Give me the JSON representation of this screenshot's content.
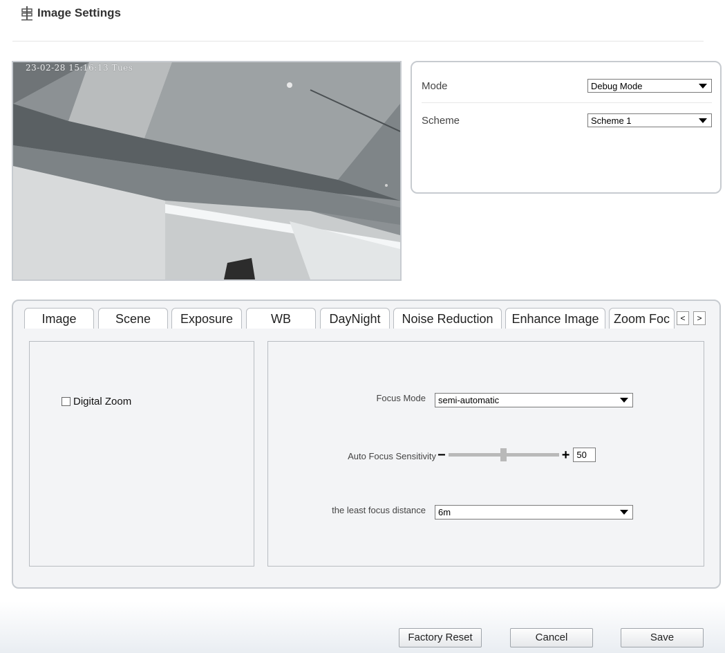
{
  "header": {
    "title": "Image Settings",
    "icon": "signpost-icon"
  },
  "preview": {
    "osd_text": "23-02-28 15:16:13 Tues"
  },
  "mode_panel": {
    "mode_label": "Mode",
    "mode_value": "Debug Mode",
    "scheme_label": "Scheme",
    "scheme_value": "Scheme 1"
  },
  "tabs": [
    {
      "label": "Image"
    },
    {
      "label": "Scene"
    },
    {
      "label": "Exposure"
    },
    {
      "label": "WB"
    },
    {
      "label": "DayNight"
    },
    {
      "label": "Noise Reduction"
    },
    {
      "label": "Enhance Image"
    },
    {
      "label": "Zoom Foc",
      "active": true
    }
  ],
  "tab_scroll": {
    "left": "<",
    "right": ">"
  },
  "zoom_focus": {
    "digital_zoom_label": "Digital Zoom",
    "digital_zoom_checked": false,
    "focus_mode_label": "Focus Mode",
    "focus_mode_value": "semi-automatic",
    "af_sensitivity_label": "Auto Focus Sensitivity",
    "af_sensitivity_value": "50",
    "least_distance_label": "the least focus distance",
    "least_distance_value": "6m"
  },
  "buttons": {
    "factory_reset": "Factory Reset",
    "cancel": "Cancel",
    "save": "Save"
  }
}
